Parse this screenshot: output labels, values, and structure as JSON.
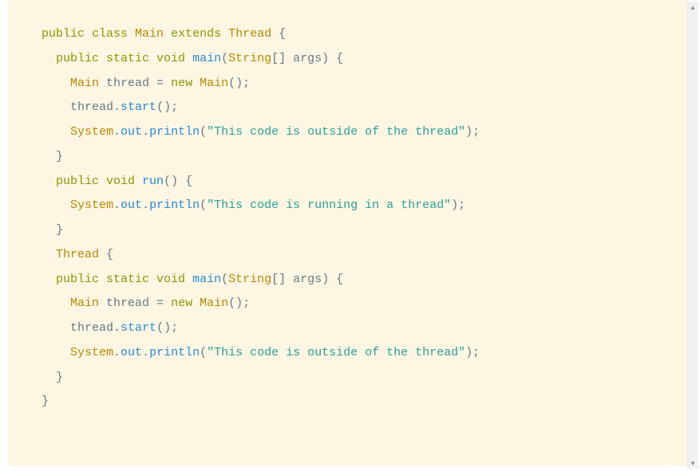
{
  "code": {
    "lines": [
      {
        "indent": 0,
        "tokens": [
          {
            "t": "public ",
            "c": "kw-public"
          },
          {
            "t": "class ",
            "c": "kw-class"
          },
          {
            "t": "Main",
            "c": "classname"
          },
          {
            "t": " ",
            "c": "ident"
          },
          {
            "t": "extends ",
            "c": "kw-extends"
          },
          {
            "t": "Thread",
            "c": "classname"
          },
          {
            "t": " {",
            "c": "brace"
          }
        ]
      },
      {
        "indent": 1,
        "tokens": [
          {
            "t": "public static ",
            "c": "kw-public"
          },
          {
            "t": "void ",
            "c": "kw-void"
          },
          {
            "t": "main",
            "c": "method"
          },
          {
            "t": "(",
            "c": "paren"
          },
          {
            "t": "String",
            "c": "type"
          },
          {
            "t": "[] ",
            "c": "bracket"
          },
          {
            "t": "args",
            "c": "ident"
          },
          {
            "t": ")",
            "c": "paren"
          },
          {
            "t": " {",
            "c": "brace"
          }
        ]
      },
      {
        "indent": 2,
        "tokens": [
          {
            "t": "Main",
            "c": "classname"
          },
          {
            "t": " thread ",
            "c": "ident"
          },
          {
            "t": "= ",
            "c": "ident"
          },
          {
            "t": "new ",
            "c": "kw-new"
          },
          {
            "t": "Main",
            "c": "classname"
          },
          {
            "t": "();",
            "c": "paren"
          }
        ]
      },
      {
        "indent": 2,
        "tokens": [
          {
            "t": "thread",
            "c": "ident"
          },
          {
            "t": ".",
            "c": "dot"
          },
          {
            "t": "start",
            "c": "method"
          },
          {
            "t": "();",
            "c": "paren"
          }
        ]
      },
      {
        "indent": 2,
        "tokens": [
          {
            "t": "System",
            "c": "classname"
          },
          {
            "t": ".",
            "c": "dot"
          },
          {
            "t": "out",
            "c": "out"
          },
          {
            "t": ".",
            "c": "dot"
          },
          {
            "t": "println",
            "c": "method"
          },
          {
            "t": "(",
            "c": "paren"
          },
          {
            "t": "\"This code is outside of the thread\"",
            "c": "string"
          },
          {
            "t": ");",
            "c": "paren"
          }
        ]
      },
      {
        "indent": 1,
        "tokens": [
          {
            "t": "}",
            "c": "brace"
          }
        ]
      },
      {
        "indent": 1,
        "tokens": [
          {
            "t": "public ",
            "c": "kw-public"
          },
          {
            "t": "void ",
            "c": "kw-void"
          },
          {
            "t": "run",
            "c": "method"
          },
          {
            "t": "() {",
            "c": "paren"
          }
        ]
      },
      {
        "indent": 2,
        "tokens": [
          {
            "t": "System",
            "c": "classname"
          },
          {
            "t": ".",
            "c": "dot"
          },
          {
            "t": "out",
            "c": "out"
          },
          {
            "t": ".",
            "c": "dot"
          },
          {
            "t": "println",
            "c": "method"
          },
          {
            "t": "(",
            "c": "paren"
          },
          {
            "t": "\"This code is running in a thread\"",
            "c": "string"
          },
          {
            "t": ");",
            "c": "paren"
          }
        ]
      },
      {
        "indent": 1,
        "tokens": [
          {
            "t": "}",
            "c": "brace"
          }
        ]
      },
      {
        "indent": 1,
        "tokens": [
          {
            "t": "Thread",
            "c": "classname"
          },
          {
            "t": " {",
            "c": "brace"
          }
        ]
      },
      {
        "indent": 1,
        "tokens": [
          {
            "t": "public static ",
            "c": "kw-public"
          },
          {
            "t": "void ",
            "c": "kw-void"
          },
          {
            "t": "main",
            "c": "method"
          },
          {
            "t": "(",
            "c": "paren"
          },
          {
            "t": "String",
            "c": "type"
          },
          {
            "t": "[] ",
            "c": "bracket"
          },
          {
            "t": "args",
            "c": "ident"
          },
          {
            "t": ")",
            "c": "paren"
          },
          {
            "t": " {",
            "c": "brace"
          }
        ]
      },
      {
        "indent": 2,
        "tokens": [
          {
            "t": "Main",
            "c": "classname"
          },
          {
            "t": " thread ",
            "c": "ident"
          },
          {
            "t": "= ",
            "c": "ident"
          },
          {
            "t": "new ",
            "c": "kw-new"
          },
          {
            "t": "Main",
            "c": "classname"
          },
          {
            "t": "();",
            "c": "paren"
          }
        ]
      },
      {
        "indent": 2,
        "tokens": [
          {
            "t": "thread",
            "c": "ident"
          },
          {
            "t": ".",
            "c": "dot"
          },
          {
            "t": "start",
            "c": "method"
          },
          {
            "t": "();",
            "c": "paren"
          }
        ]
      },
      {
        "indent": 2,
        "tokens": [
          {
            "t": "System",
            "c": "classname"
          },
          {
            "t": ".",
            "c": "dot"
          },
          {
            "t": "out",
            "c": "out"
          },
          {
            "t": ".",
            "c": "dot"
          },
          {
            "t": "println",
            "c": "method"
          },
          {
            "t": "(",
            "c": "paren"
          },
          {
            "t": "\"This code is outside of the thread\"",
            "c": "string"
          },
          {
            "t": ");",
            "c": "paren"
          }
        ]
      },
      {
        "indent": 1,
        "tokens": [
          {
            "t": "}",
            "c": "brace"
          }
        ]
      },
      {
        "indent": 0,
        "tokens": [
          {
            "t": "}",
            "c": "brace"
          }
        ]
      }
    ]
  },
  "colors": {
    "background": "#fdf6e3",
    "default": "#657b83",
    "keyword": "#859900",
    "type": "#b58900",
    "method": "#268bd2",
    "string": "#2aa198"
  }
}
